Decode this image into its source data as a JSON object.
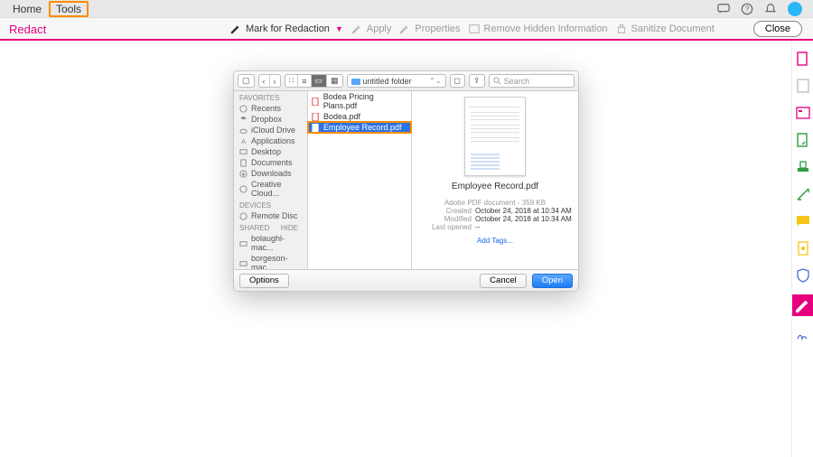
{
  "menubar": {
    "home": "Home",
    "tools": "Tools"
  },
  "ribbon": {
    "label": "Redact",
    "tools": {
      "mark": "Mark for Redaction",
      "apply": "Apply",
      "properties": "Properties",
      "remove_hidden": "Remove Hidden Information",
      "sanitize": "Sanitize Document"
    },
    "close": "Close"
  },
  "dialog": {
    "folder": "untitled folder",
    "search_placeholder": "Search",
    "sidebar": {
      "favorites": "Favorites",
      "items": [
        "Recents",
        "Dropbox",
        "iCloud Drive",
        "Applications",
        "Desktop",
        "Documents",
        "Downloads",
        "Creative Cloud..."
      ],
      "devices": "Devices",
      "device_items": [
        "Remote Disc"
      ],
      "shared": "Shared",
      "hide": "Hide",
      "shared_items": [
        "bolaughl-mac...",
        "borgeson-mac..."
      ]
    },
    "files": [
      "Bodea Pricing Plans.pdf",
      "Bodea.pdf",
      "Employee Record.pdf"
    ],
    "preview": {
      "name": "Employee Record.pdf",
      "kind": "Adobe PDF document - 359 KB",
      "created_k": "Created",
      "created_v": "October 24, 2018 at 10:34 AM",
      "modified_k": "Modified",
      "modified_v": "October 24, 2018 at 10:34 AM",
      "lastopened_k": "Last opened",
      "lastopened_v": "--",
      "addtags": "Add Tags..."
    },
    "buttons": {
      "options": "Options",
      "cancel": "Cancel",
      "open": "Open"
    }
  },
  "right_strip_icons": [
    "pdf-icon",
    "export-icon",
    "form-icon",
    "create-icon",
    "stamp-icon",
    "measure-icon",
    "comment-icon",
    "protect-icon",
    "shield-icon",
    "redact-pen-icon",
    "sign-icon"
  ]
}
